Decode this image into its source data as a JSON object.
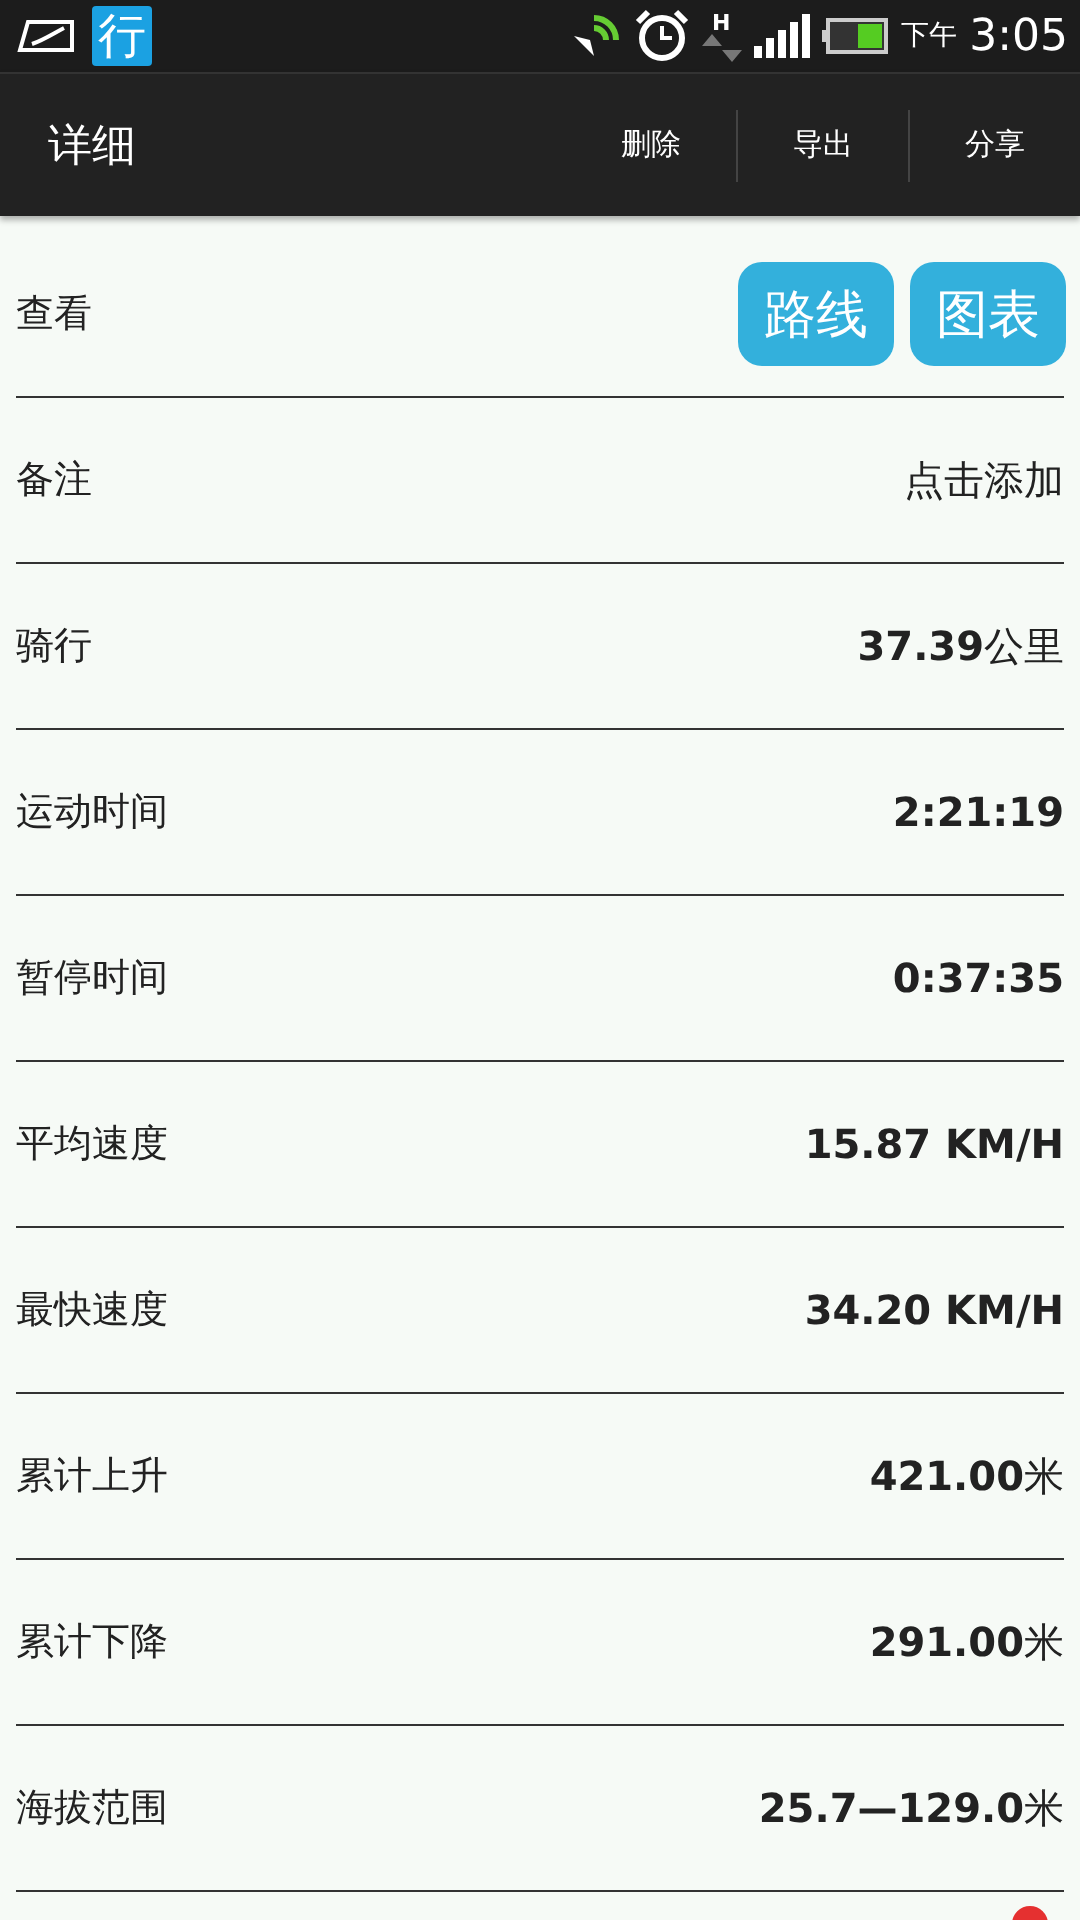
{
  "status_bar": {
    "app_badge": "行",
    "network_letter": "H",
    "period": "下午",
    "time": "3:05"
  },
  "header": {
    "title": "详细",
    "actions": [
      "删除",
      "导出",
      "分享"
    ]
  },
  "rows": [
    {
      "kind": "buttons",
      "label": "查看",
      "buttons": [
        "路线",
        "图表"
      ]
    },
    {
      "kind": "text",
      "label": "备注",
      "value": "点击添加",
      "bold": false
    },
    {
      "kind": "text",
      "label": "骑行",
      "value": "**37.39**公里",
      "bold": false
    },
    {
      "kind": "text",
      "label": "运动时间",
      "value": "2:21:19",
      "bold": true
    },
    {
      "kind": "text",
      "label": "暂停时间",
      "value": "0:37:35",
      "bold": true
    },
    {
      "kind": "text",
      "label": "平均速度",
      "value": "15.87 KM/H",
      "bold": true
    },
    {
      "kind": "text",
      "label": "最快速度",
      "value": "34.20 KM/H",
      "bold": true
    },
    {
      "kind": "text",
      "label": "累计上升",
      "value": "**421.00**米",
      "bold": false
    },
    {
      "kind": "text",
      "label": "累计下降",
      "value": "**291.00**米",
      "bold": false
    },
    {
      "kind": "text",
      "label": "海拔范围",
      "value": "**25.7—129.0**米",
      "bold": false
    }
  ]
}
